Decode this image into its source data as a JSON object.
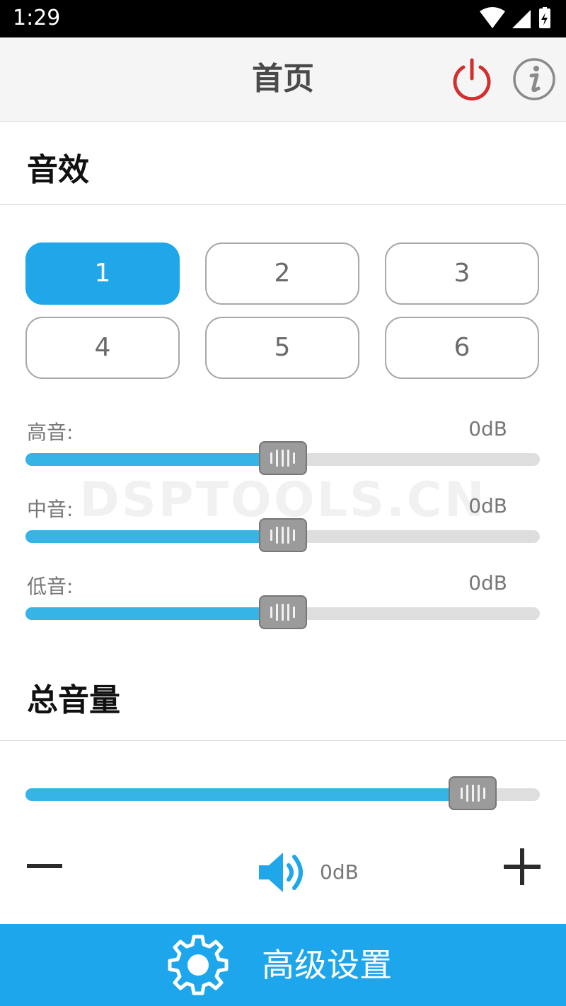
{
  "status_bar": {
    "time": "1:29"
  },
  "app_bar": {
    "title": "首页"
  },
  "sound_effects": {
    "title": "音效",
    "presets": [
      "1",
      "2",
      "3",
      "4",
      "5",
      "6"
    ],
    "active_preset": "1"
  },
  "eq": {
    "treble": {
      "label": "高音:",
      "value": "0dB",
      "level": 0.5
    },
    "mid": {
      "label": "中音:",
      "value": "0dB",
      "level": 0.5
    },
    "bass": {
      "label": "低音:",
      "value": "0dB",
      "level": 0.5
    }
  },
  "watermark": "DSPTOOLS.CN",
  "master_volume": {
    "title": "总音量",
    "value": "0dB",
    "level": 0.87
  },
  "bottom_bar": {
    "label": "高级设置"
  },
  "colors": {
    "accent": "#1fa7ea",
    "slider_fill": "#36b4e5",
    "power_red": "#d32f2f",
    "status_bar": "#000000"
  },
  "icons": {
    "power": "power-icon",
    "info": "info-icon",
    "speaker": "speaker-icon",
    "gear": "gear-icon",
    "minus": "minus-icon",
    "plus": "plus-icon"
  }
}
